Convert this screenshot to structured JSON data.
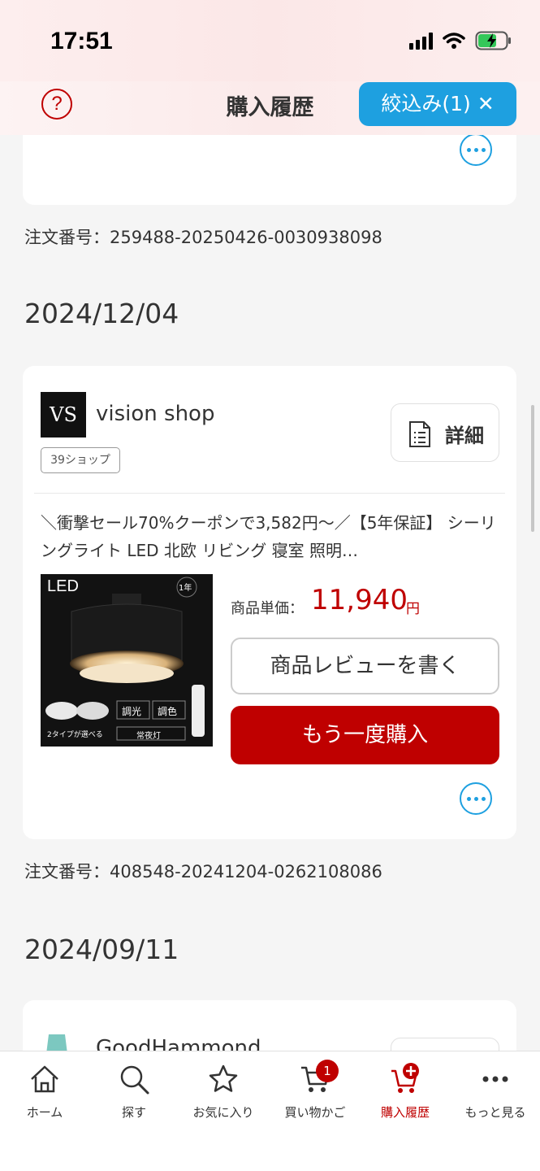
{
  "status_bar": {
    "time": "17:51"
  },
  "header": {
    "help_icon": "question-circle-icon",
    "title": "購入履歴",
    "filter_label": "絞込み(1)",
    "filter_close": "✕"
  },
  "orders": [
    {
      "order_number": "注文番号：259488-20250426-0030938098"
    },
    {
      "date": "2024/12/04",
      "shop": {
        "logo_text": "VS",
        "name": "vision shop",
        "tag": "39ショップ"
      },
      "detail_label": "詳細",
      "product_title": "＼衝撃セール70%クーポンで3,582円～／【5年保証】 シーリングライト LED 北欧 リビング 寝室 照明…",
      "image_text": {
        "led": "LED",
        "badge": "1年",
        "dimming": "調光",
        "color": "調色",
        "nightlight": "常夜灯",
        "types": "2タイプが選べる"
      },
      "price_label": "商品単価：",
      "price": "11,940",
      "price_unit": "円",
      "review_label": "商品レビューを書く",
      "rebuy_label": "もう一度購入",
      "order_number": "注文番号：408548-20241204-0262108086"
    },
    {
      "date": "2024/09/11",
      "shop": {
        "name": "GoodHammond"
      }
    }
  ],
  "bottom_nav": {
    "items": [
      {
        "label": "ホーム",
        "icon": "home-icon"
      },
      {
        "label": "探す",
        "icon": "search-icon"
      },
      {
        "label": "お気に入り",
        "icon": "star-icon"
      },
      {
        "label": "買い物かご",
        "icon": "cart-icon",
        "badge": "1"
      },
      {
        "label": "購入履歴",
        "icon": "cart-plus-icon",
        "active": true
      },
      {
        "label": "もっと見る",
        "icon": "more-icon"
      }
    ]
  },
  "colors": {
    "accent_red": "#bf0000",
    "accent_blue": "#1ea0e0"
  }
}
